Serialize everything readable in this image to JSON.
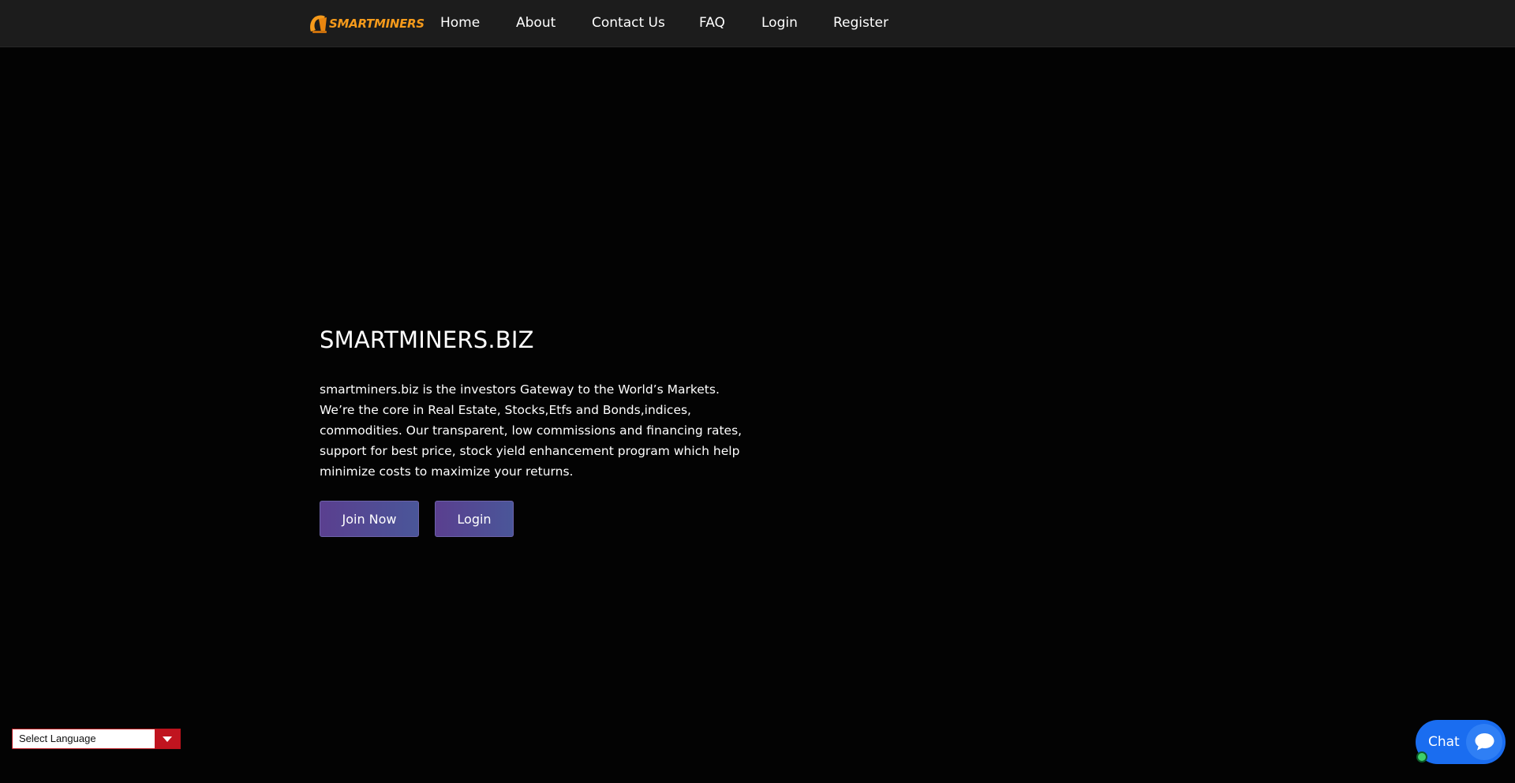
{
  "header": {
    "logo_text": "SMARTMINERS",
    "logo_icon": "mining-helmet-icon",
    "brand_color": "#f59a1b",
    "nav": [
      {
        "label": "Home"
      },
      {
        "label": "About"
      },
      {
        "label": "Contact Us"
      },
      {
        "label": "FAQ"
      },
      {
        "label": "Login"
      },
      {
        "label": "Register"
      }
    ]
  },
  "hero": {
    "title": "SMARTMINERS.BIZ",
    "description": "smartminers.biz is the investors Gateway to the World’s Markets. We’re the core in Real Estate, Stocks,Etfs and Bonds,indices, commodities. Our transparent, low commissions and financing rates, support for best price, stock yield enhancement program which help minimize costs to maximize your returns.",
    "buttons": {
      "join_label": "Join Now",
      "login_label": "Login",
      "button_color": "#5a3f8f"
    }
  },
  "language_selector": {
    "label": "Select Language",
    "icon": "caret-down-icon",
    "accent_color": "#c0141f"
  },
  "chat_widget": {
    "label": "Chat",
    "icon": "chat-bubble-icon",
    "color": "#1a6df0",
    "status_color": "#3ed06a"
  }
}
